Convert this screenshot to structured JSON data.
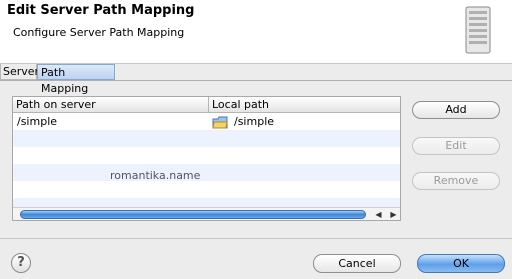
{
  "header": {
    "title": "Edit Server Path Mapping",
    "subtitle": "Configure Server Path Mapping",
    "icon": "server-icon"
  },
  "tabs": [
    {
      "label": "Server",
      "selected": false
    },
    {
      "label": "Path Mapping",
      "selected": true
    }
  ],
  "table": {
    "columns": [
      "Path on server",
      "Local path"
    ],
    "rows": [
      {
        "path_on_server": "/simple",
        "local_path": "/simple",
        "local_icon": "folder-icon"
      }
    ],
    "watermark": "romantika.name"
  },
  "side_buttons": {
    "add": "Add",
    "edit": "Edit",
    "remove": "Remove"
  },
  "footer": {
    "help_icon": "help-icon",
    "help_glyph": "?",
    "cancel": "Cancel",
    "ok": "OK"
  },
  "colors": {
    "selection_accent": "#5da0ea",
    "alt_row": "#edf3fe"
  }
}
